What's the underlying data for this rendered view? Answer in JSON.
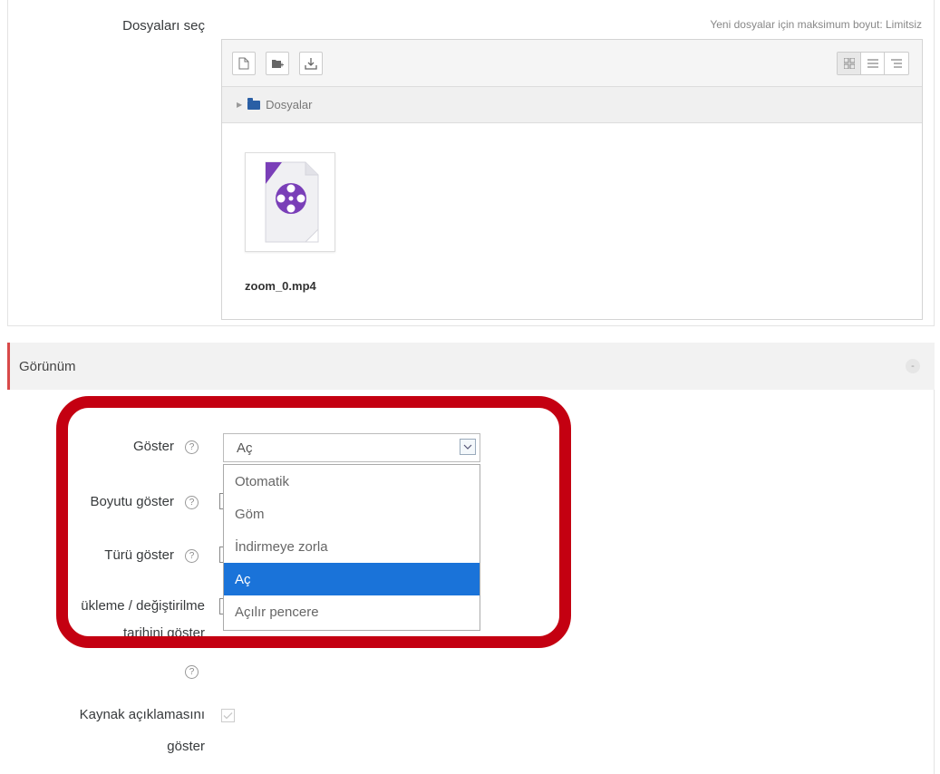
{
  "files": {
    "label": "Dosyaları seç",
    "max_size": "Yeni dosyalar için maksimum boyut: Limitsiz",
    "path_label": "Dosyalar",
    "file_name": "zoom_0.mp4"
  },
  "appearance": {
    "section_title": "Görünüm",
    "collapse_glyph": "-",
    "display_label": "Göster",
    "display_value": "Aç",
    "display_options": [
      "Otomatik",
      "Göm",
      "İndirmeye zorla",
      "Aç",
      "Açılır pencere"
    ],
    "selected_index": 3,
    "show_size_label": "Boyutu göster",
    "show_type_label": "Türü göster",
    "show_date_label_line1": "ükleme / değiştirilme",
    "show_date_label_line2": "tarihini göster",
    "show_desc_label_line1": "Kaynak açıklamasını",
    "show_desc_label_line2": "göster",
    "help_glyph": "?"
  },
  "colors": {
    "highlight": "#c40011",
    "selected_option": "#1a73d9",
    "section_accent": "#d84a4a"
  }
}
